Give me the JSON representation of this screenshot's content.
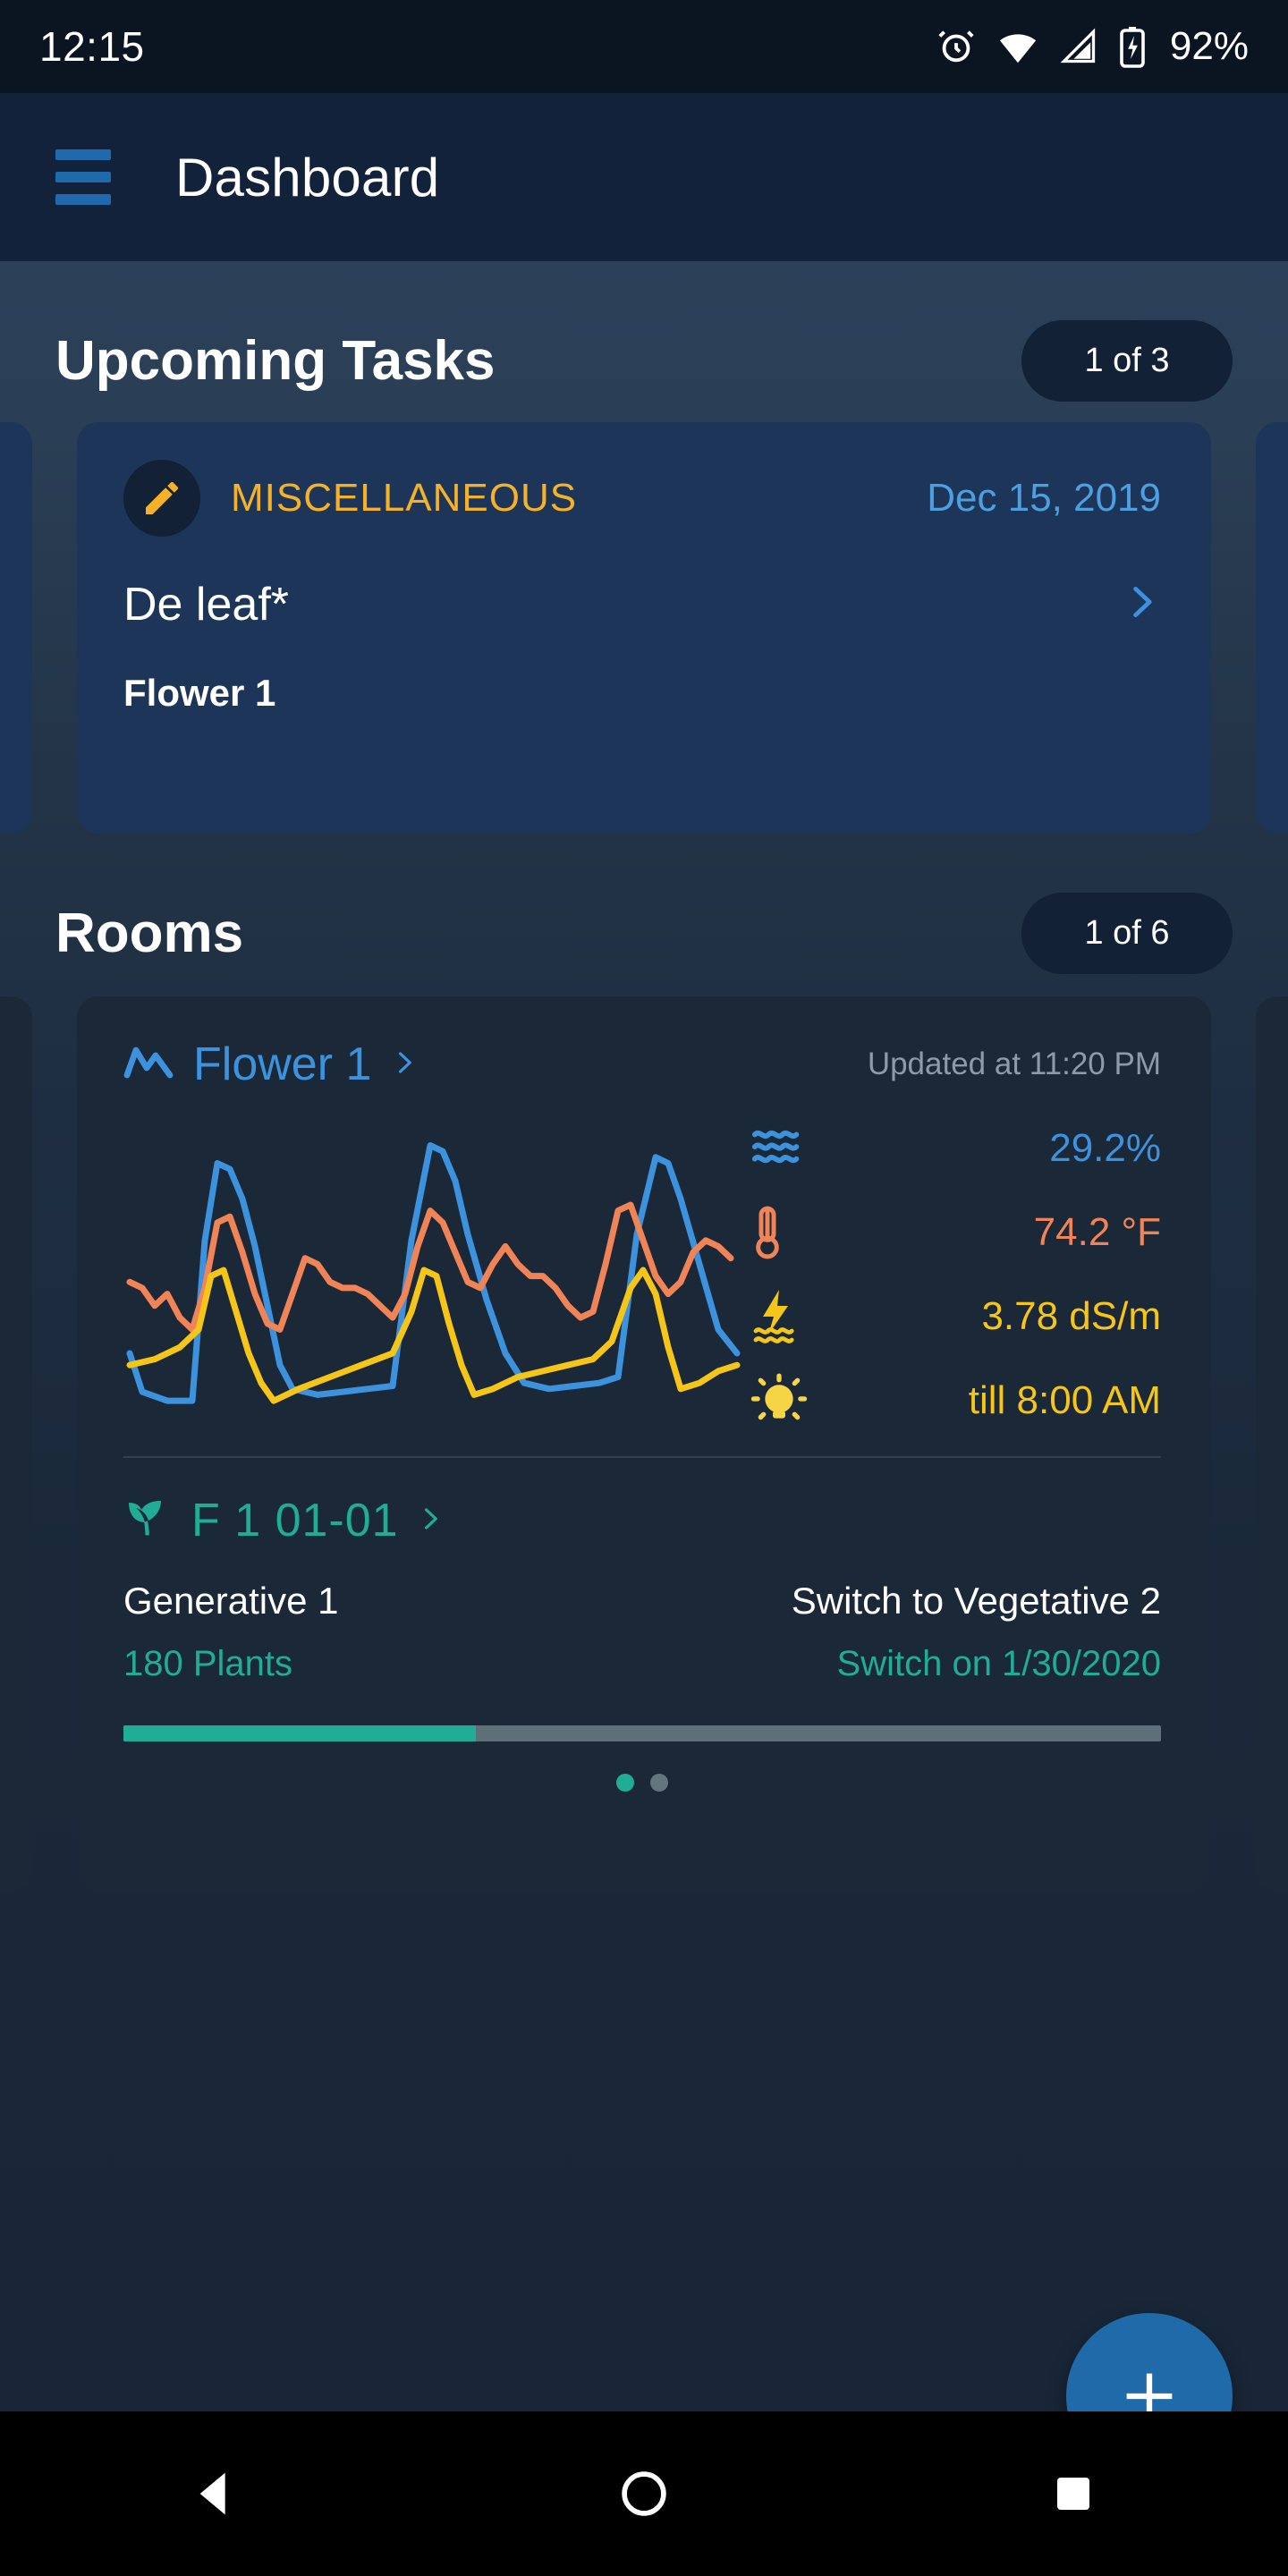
{
  "status_bar": {
    "clock": "12:15",
    "battery_percent": "92%",
    "icons": [
      "alarm-icon",
      "wifi-icon",
      "signal-icon",
      "battery-charging-icon"
    ]
  },
  "app_bar": {
    "menu_icon": "hamburger-menu-icon",
    "title": "Dashboard"
  },
  "upcoming_tasks": {
    "title": "Upcoming Tasks",
    "count_label": "1 of 3",
    "card": {
      "icon": "pencil-icon",
      "category": "MISCELLANEOUS",
      "date": "Dec 15, 2019",
      "name": "De leaf*",
      "room": "Flower 1",
      "chevron": "chevron-right-icon"
    }
  },
  "rooms": {
    "title": "Rooms",
    "count_label": "1 of 6",
    "card": {
      "trend_icon": "trend-line-icon",
      "name": "Flower 1",
      "chevron": "chevron-right-icon",
      "updated": "Updated at 11:20 PM",
      "metrics": [
        {
          "icon": "humidity-waves-icon",
          "value": "29.2%",
          "color": "#3d92de"
        },
        {
          "icon": "thermometer-icon",
          "value": "74.2 °F",
          "color": "#f08457"
        },
        {
          "icon": "ec-lightning-icon",
          "value": "3.78 dS/m",
          "color": "#f5c518"
        },
        {
          "icon": "light-bulb-icon",
          "value": "till 8:00 AM",
          "color": "#f5c518"
        }
      ],
      "batch": {
        "leaf_icon": "leaf-icon",
        "name": "F 1 01-01",
        "chevron": "chevron-right-icon",
        "stage": "Generative 1",
        "plants": "180 Plants",
        "next_stage": "Switch to Vegetative 2",
        "switch_date": "Switch on 1/30/2020",
        "progress_percent": 34
      },
      "pager": {
        "total": 2,
        "active": 0
      }
    }
  },
  "fab": {
    "icon": "plus-icon",
    "label": "+"
  },
  "nav_bar": {
    "back": "back-triangle-icon",
    "home": "home-circle-icon",
    "recents": "recents-square-icon"
  },
  "chart_data": {
    "type": "line",
    "title": "",
    "xlabel": "",
    "ylabel": "",
    "grid": false,
    "legend": "none",
    "xlim": [
      0,
      100
    ],
    "ylim": [
      0,
      100
    ],
    "series": [
      {
        "name": "Humidity",
        "color": "#3d92de",
        "points": [
          [
            1,
            22
          ],
          [
            3,
            9
          ],
          [
            7,
            6
          ],
          [
            11,
            6
          ],
          [
            13,
            60
          ],
          [
            15,
            86
          ],
          [
            17,
            84
          ],
          [
            19,
            74
          ],
          [
            21,
            58
          ],
          [
            23,
            38
          ],
          [
            25,
            18
          ],
          [
            27,
            10
          ],
          [
            31,
            8
          ],
          [
            35,
            9
          ],
          [
            39,
            10
          ],
          [
            43,
            11
          ],
          [
            46,
            60
          ],
          [
            49,
            92
          ],
          [
            51,
            90
          ],
          [
            53,
            80
          ],
          [
            55,
            62
          ],
          [
            58,
            40
          ],
          [
            61,
            22
          ],
          [
            64,
            12
          ],
          [
            68,
            10
          ],
          [
            72,
            11
          ],
          [
            76,
            12
          ],
          [
            79,
            14
          ],
          [
            82,
            62
          ],
          [
            85,
            88
          ],
          [
            87,
            86
          ],
          [
            89,
            74
          ],
          [
            92,
            52
          ],
          [
            95,
            30
          ],
          [
            98,
            22
          ]
        ]
      },
      {
        "name": "Temperature",
        "color": "#f08457",
        "points": [
          [
            1,
            46
          ],
          [
            3,
            44
          ],
          [
            5,
            38
          ],
          [
            7,
            42
          ],
          [
            9,
            34
          ],
          [
            11,
            30
          ],
          [
            13,
            44
          ],
          [
            15,
            66
          ],
          [
            17,
            68
          ],
          [
            19,
            56
          ],
          [
            21,
            42
          ],
          [
            23,
            32
          ],
          [
            25,
            30
          ],
          [
            27,
            42
          ],
          [
            29,
            54
          ],
          [
            31,
            52
          ],
          [
            33,
            46
          ],
          [
            35,
            44
          ],
          [
            37,
            44
          ],
          [
            39,
            42
          ],
          [
            41,
            38
          ],
          [
            43,
            34
          ],
          [
            45,
            42
          ],
          [
            47,
            58
          ],
          [
            49,
            70
          ],
          [
            51,
            66
          ],
          [
            53,
            56
          ],
          [
            55,
            46
          ],
          [
            57,
            44
          ],
          [
            59,
            52
          ],
          [
            61,
            58
          ],
          [
            63,
            52
          ],
          [
            65,
            48
          ],
          [
            67,
            48
          ],
          [
            69,
            44
          ],
          [
            71,
            38
          ],
          [
            73,
            34
          ],
          [
            75,
            36
          ],
          [
            77,
            52
          ],
          [
            79,
            70
          ],
          [
            81,
            72
          ],
          [
            83,
            60
          ],
          [
            85,
            48
          ],
          [
            87,
            42
          ],
          [
            89,
            46
          ],
          [
            91,
            56
          ],
          [
            93,
            60
          ],
          [
            95,
            58
          ],
          [
            97,
            54
          ]
        ]
      },
      {
        "name": "EC",
        "color": "#f5c518",
        "points": [
          [
            1,
            18
          ],
          [
            5,
            20
          ],
          [
            9,
            24
          ],
          [
            12,
            30
          ],
          [
            14,
            48
          ],
          [
            16,
            50
          ],
          [
            18,
            36
          ],
          [
            20,
            22
          ],
          [
            22,
            12
          ],
          [
            24,
            6
          ],
          [
            28,
            10
          ],
          [
            33,
            14
          ],
          [
            38,
            18
          ],
          [
            43,
            22
          ],
          [
            46,
            36
          ],
          [
            48,
            50
          ],
          [
            50,
            48
          ],
          [
            52,
            32
          ],
          [
            54,
            18
          ],
          [
            56,
            8
          ],
          [
            59,
            10
          ],
          [
            63,
            14
          ],
          [
            67,
            16
          ],
          [
            71,
            18
          ],
          [
            75,
            20
          ],
          [
            78,
            26
          ],
          [
            81,
            44
          ],
          [
            83,
            50
          ],
          [
            85,
            42
          ],
          [
            87,
            24
          ],
          [
            89,
            10
          ],
          [
            92,
            12
          ],
          [
            95,
            16
          ],
          [
            98,
            18
          ]
        ]
      }
    ]
  }
}
